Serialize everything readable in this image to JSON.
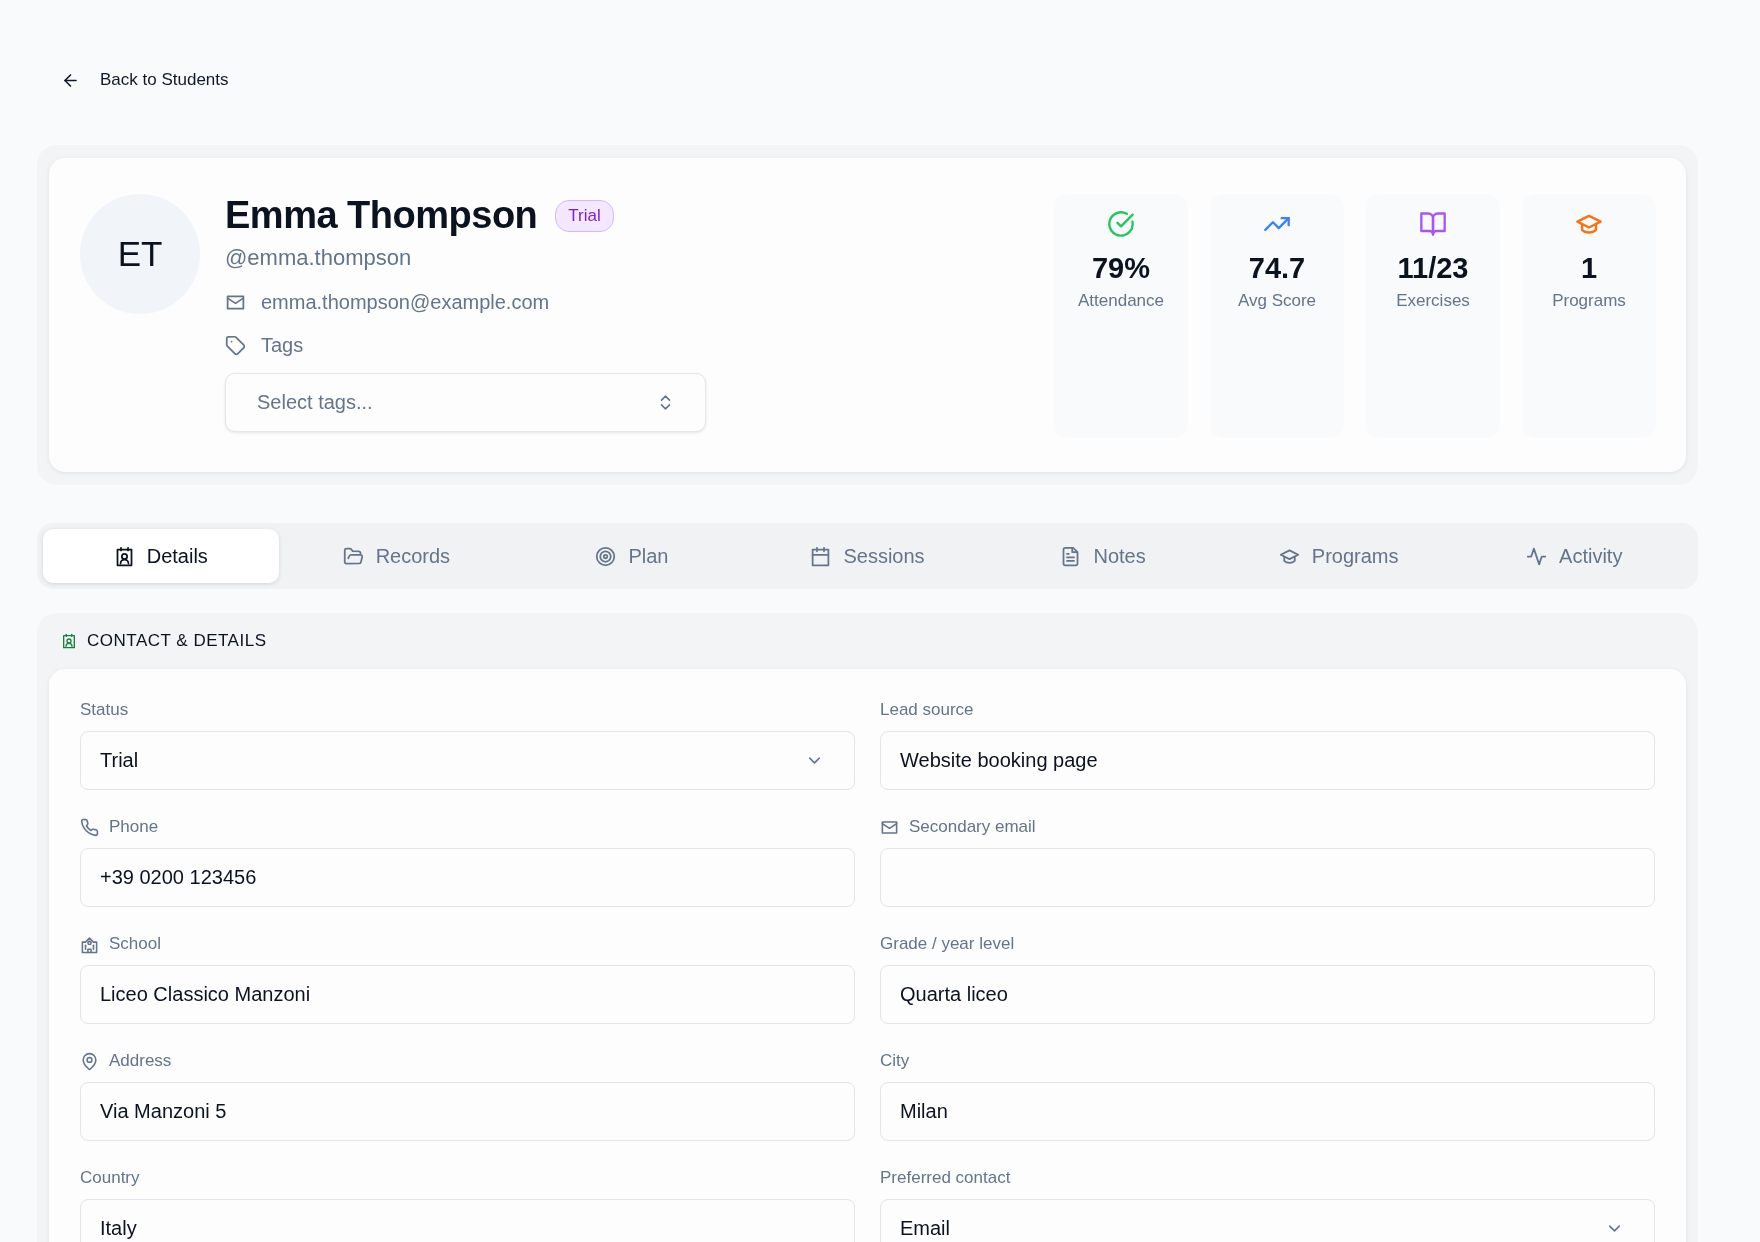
{
  "back_link": "Back to Students",
  "profile": {
    "initials": "ET",
    "name": "Emma Thompson",
    "badge": "Trial",
    "username": "@emma.thompson",
    "email": "emma.thompson@example.com",
    "tags_label": "Tags",
    "tags_placeholder": "Select tags..."
  },
  "stats": [
    {
      "value": "79%",
      "label": "Attendance",
      "color": "#22c55e"
    },
    {
      "value": "74.7",
      "label": "Avg Score",
      "color": "#3b82f6"
    },
    {
      "value": "11/23",
      "label": "Exercises",
      "color": "#a855f7"
    },
    {
      "value": "1",
      "label": "Programs",
      "color": "#f97316"
    }
  ],
  "tabs": [
    {
      "label": "Details",
      "selected": true
    },
    {
      "label": "Records",
      "selected": false
    },
    {
      "label": "Plan",
      "selected": false
    },
    {
      "label": "Sessions",
      "selected": false
    },
    {
      "label": "Notes",
      "selected": false
    },
    {
      "label": "Programs",
      "selected": false
    },
    {
      "label": "Activity",
      "selected": false
    }
  ],
  "section": {
    "title": "CONTACT & DETAILS"
  },
  "fields": [
    {
      "label": "Status",
      "kind": "select",
      "value": "Trial"
    },
    {
      "label": "Lead source",
      "kind": "text",
      "value": "Website booking page"
    },
    {
      "label": "Phone",
      "kind": "text",
      "value": "+39 0200 123456"
    },
    {
      "label": "Secondary email",
      "kind": "text"
    },
    {
      "label": "School",
      "kind": "text",
      "value": "Liceo Classico Manzoni"
    },
    {
      "label": "Grade / year level",
      "kind": "text",
      "value": "Quarta liceo"
    },
    {
      "label": "Address",
      "kind": "text",
      "value": "Via Manzoni 5"
    },
    {
      "label": "City",
      "kind": "text",
      "value": "Milan"
    },
    {
      "label": "Country",
      "kind": "text",
      "value": "Italy"
    },
    {
      "label": "Preferred contact",
      "kind": "select",
      "value": "Email"
    }
  ]
}
